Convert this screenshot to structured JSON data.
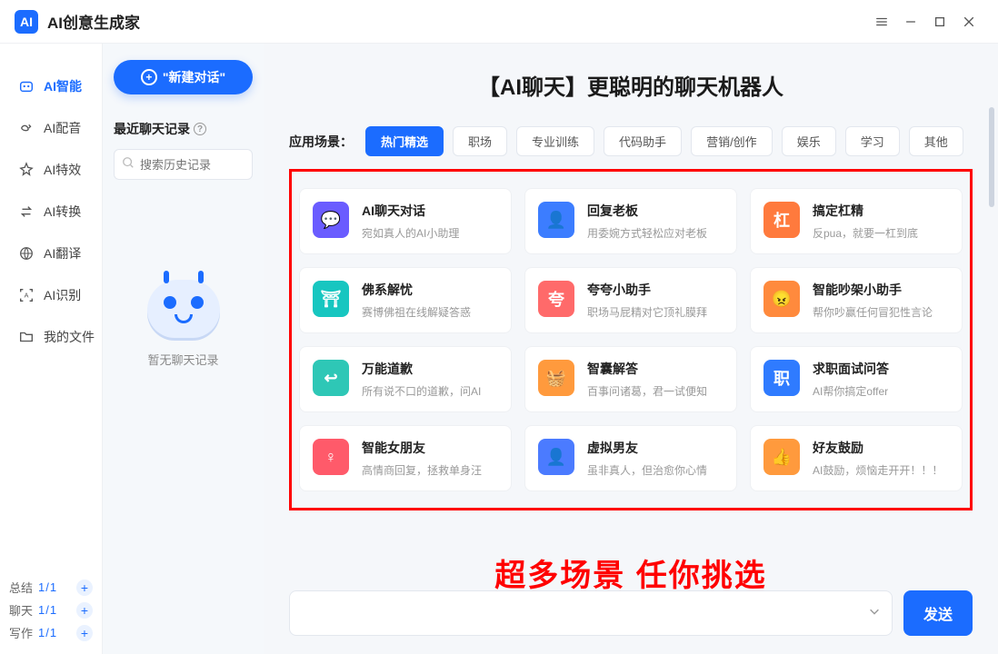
{
  "app": {
    "title": "AI创意生成家",
    "logo_text": "AI"
  },
  "nav": {
    "items": [
      {
        "label": "AI智能"
      },
      {
        "label": "AI配音"
      },
      {
        "label": "AI特效"
      },
      {
        "label": "AI转换"
      },
      {
        "label": "AI翻译"
      },
      {
        "label": "AI识别"
      },
      {
        "label": "我的文件"
      }
    ],
    "footer": {
      "summary_label": "总结",
      "summary_count": "1/1",
      "chat_label": "聊天",
      "chat_count": "1/1",
      "write_label": "写作",
      "write_count": "1/1"
    }
  },
  "session": {
    "new_chat_label": "\"新建对话\"",
    "recent_label": "最近聊天记录",
    "search_placeholder": "搜索历史记录",
    "empty_hint": "暂无聊天记录"
  },
  "main": {
    "title": "【AI聊天】更聪明的聊天机器人",
    "tabs_label": "应用场景：",
    "tabs": [
      {
        "label": "热门精选"
      },
      {
        "label": "职场"
      },
      {
        "label": "专业训练"
      },
      {
        "label": "代码助手"
      },
      {
        "label": "营销/创作"
      },
      {
        "label": "娱乐"
      },
      {
        "label": "学习"
      },
      {
        "label": "其他"
      }
    ],
    "cards": [
      {
        "title": "AI聊天对话",
        "sub": "宛如真人的AI小助理",
        "color": "#6a5cff",
        "glyph": "💬"
      },
      {
        "title": "回复老板",
        "sub": "用委婉方式轻松应对老板",
        "color": "#3c7dff",
        "glyph": "👤"
      },
      {
        "title": "搞定杠精",
        "sub": "反pua，就要一杠到底",
        "color": "#ff7a3d",
        "glyph": "杠"
      },
      {
        "title": "佛系解忧",
        "sub": "赛博佛祖在线解疑答惑",
        "color": "#17c6c0",
        "glyph": "⛩"
      },
      {
        "title": "夸夸小助手",
        "sub": "职场马屁精对它顶礼膜拜",
        "color": "#ff6a6a",
        "glyph": "夸"
      },
      {
        "title": "智能吵架小助手",
        "sub": "帮你吵赢任何冒犯性言论",
        "color": "#ff8a3d",
        "glyph": "😠"
      },
      {
        "title": "万能道歉",
        "sub": "所有说不口的道歉，问AI",
        "color": "#2ec7b6",
        "glyph": "↩"
      },
      {
        "title": "智囊解答",
        "sub": "百事问诸葛，君一试便知",
        "color": "#ff9a3d",
        "glyph": "🧺"
      },
      {
        "title": "求职面试问答",
        "sub": "AI帮你搞定offer",
        "color": "#2f7bff",
        "glyph": "职"
      },
      {
        "title": "智能女朋友",
        "sub": "高情商回复，拯救单身汪",
        "color": "#ff5a6a",
        "glyph": "♀"
      },
      {
        "title": "虚拟男友",
        "sub": "虽非真人，但治愈你心情",
        "color": "#4b7bff",
        "glyph": "👤"
      },
      {
        "title": "好友鼓励",
        "sub": "AI鼓励，烦恼走开开！！！",
        "color": "#ff9a3d",
        "glyph": "👍"
      }
    ],
    "overlay": "超多场景 任你挑选",
    "send_label": "发送"
  }
}
